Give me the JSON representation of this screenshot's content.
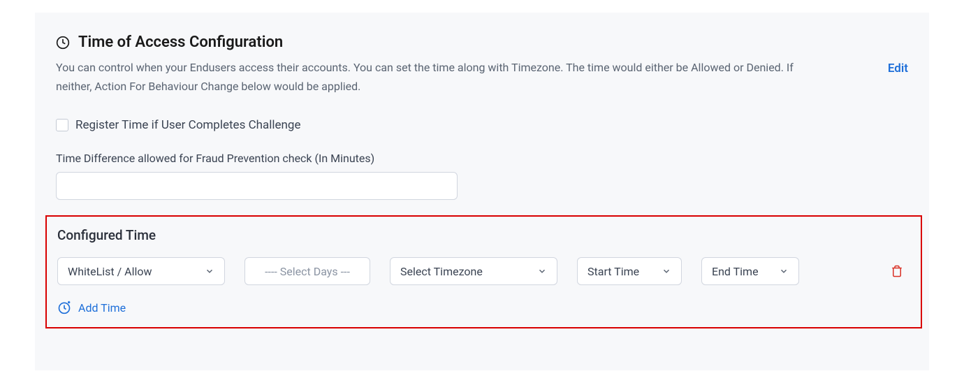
{
  "header": {
    "title": "Time of Access Configuration",
    "description": "You can control when your Endusers access their accounts. You can set the time along with Timezone. The time would either be Allowed or Denied. If neither, Action For Behaviour Change below would be applied.",
    "editLabel": "Edit"
  },
  "checkbox": {
    "label": "Register Time if User Completes Challenge"
  },
  "timeDiff": {
    "label": "Time Difference allowed for Fraud Prevention check (In Minutes)",
    "value": ""
  },
  "configured": {
    "title": "Configured Time",
    "row": {
      "whitelist": "WhiteList / Allow",
      "days": "---- Select Days ---",
      "timezone": "Select Timezone",
      "startTime": "Start Time",
      "endTime": "End Time"
    },
    "addTime": "Add Time"
  }
}
